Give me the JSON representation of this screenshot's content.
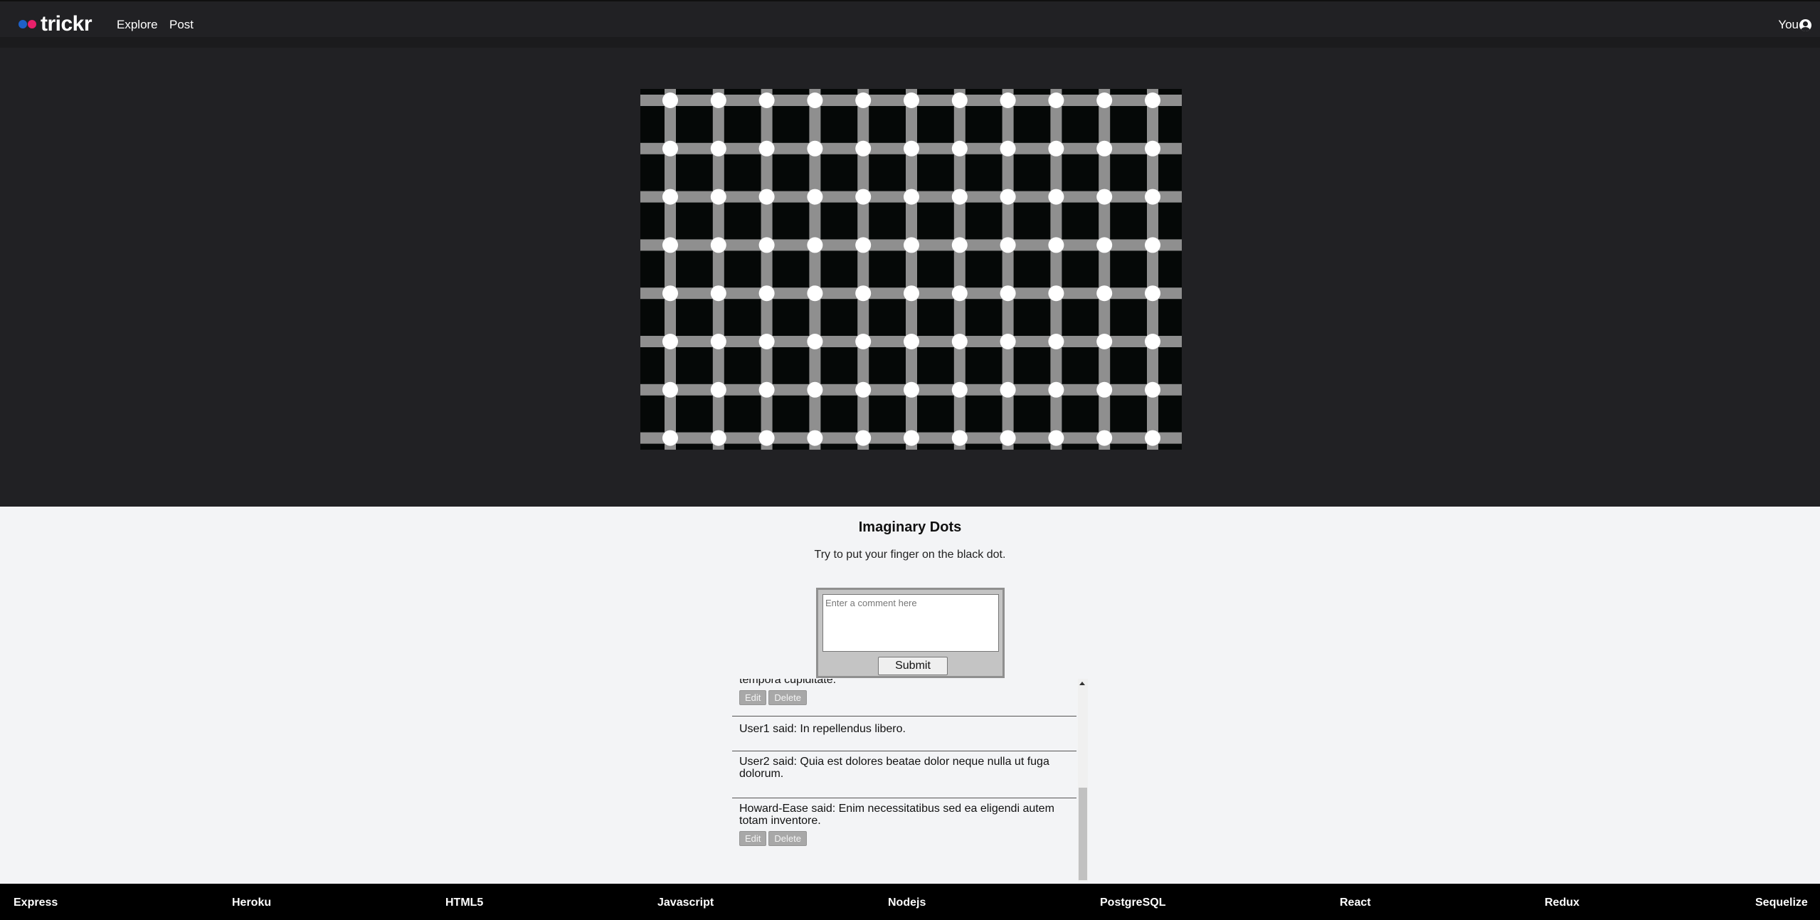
{
  "nav": {
    "logo_text": "trickr",
    "logo_colors": [
      "#1d60c7",
      "#e8206a"
    ],
    "links": [
      {
        "label": "Explore"
      },
      {
        "label": "Post"
      }
    ],
    "user_label": "You",
    "user_icon": "user-circle-icon"
  },
  "photo": {
    "title": "Imaginary Dots",
    "description": "Try to put your finger on the black dot."
  },
  "comment_form": {
    "placeholder": "Enter a comment here",
    "submit_label": "Submit"
  },
  "comments": [
    {
      "text": "tempora cupiditate.",
      "edit_label": "Edit",
      "delete_label": "Delete"
    },
    {
      "text": "User1 said: In repellendus libero."
    },
    {
      "text": "User2 said: Quia est dolores beatae dolor neque nulla ut fuga dolorum."
    },
    {
      "text": "Howard-Ease said: Enim necessitatibus sed ea eligendi autem totam inventore.",
      "edit_label": "Edit",
      "delete_label": "Delete"
    }
  ],
  "footer": {
    "items": [
      "Express",
      "Heroku",
      "HTML5",
      "Javascript",
      "Nodejs",
      "PostgreSQL",
      "React",
      "Redux",
      "Sequelize"
    ]
  },
  "colors": {
    "nav_bg": "#212124",
    "hero_bg": "#212124",
    "page_bg": "#f3f4f6",
    "footer_bg": "#000000"
  }
}
